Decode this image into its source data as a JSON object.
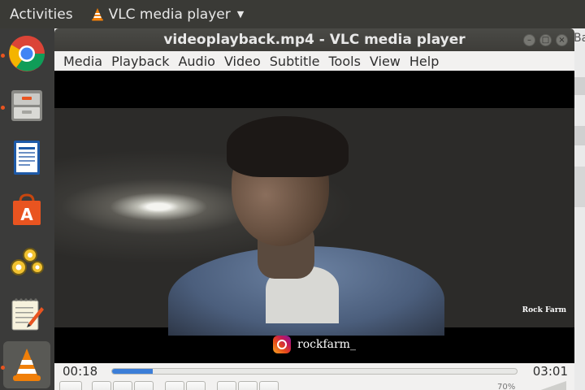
{
  "topbar": {
    "activities": "Activities",
    "app_name": "VLC media player"
  },
  "dock": {
    "items": [
      {
        "name": "chrome",
        "running": true,
        "active": false
      },
      {
        "name": "files",
        "running": true,
        "active": false
      },
      {
        "name": "writer",
        "running": false,
        "active": false
      },
      {
        "name": "software",
        "running": false,
        "active": false
      },
      {
        "name": "settings",
        "running": false,
        "active": false
      },
      {
        "name": "text-editor",
        "running": false,
        "active": false
      },
      {
        "name": "vlc",
        "running": true,
        "active": true
      }
    ]
  },
  "background_window": {
    "title_fragment": "Ba"
  },
  "window": {
    "title": "videoplayback.mp4 - VLC media player"
  },
  "menu": {
    "items": [
      {
        "label": "Media"
      },
      {
        "label": "Playback"
      },
      {
        "label": "Audio"
      },
      {
        "label": "Video"
      },
      {
        "label": "Subtitle"
      },
      {
        "label": "Tools"
      },
      {
        "label": "View"
      },
      {
        "label": "Help"
      }
    ]
  },
  "video": {
    "watermark": "Rock Farm",
    "instagram_handle": "rockfarm_"
  },
  "player": {
    "current_time": "00:18",
    "total_time": "03:01",
    "progress": 0.1,
    "volume": "70%"
  },
  "colors": {
    "accent": "#3c7ed8",
    "dock_running_dot": "#e95420"
  }
}
